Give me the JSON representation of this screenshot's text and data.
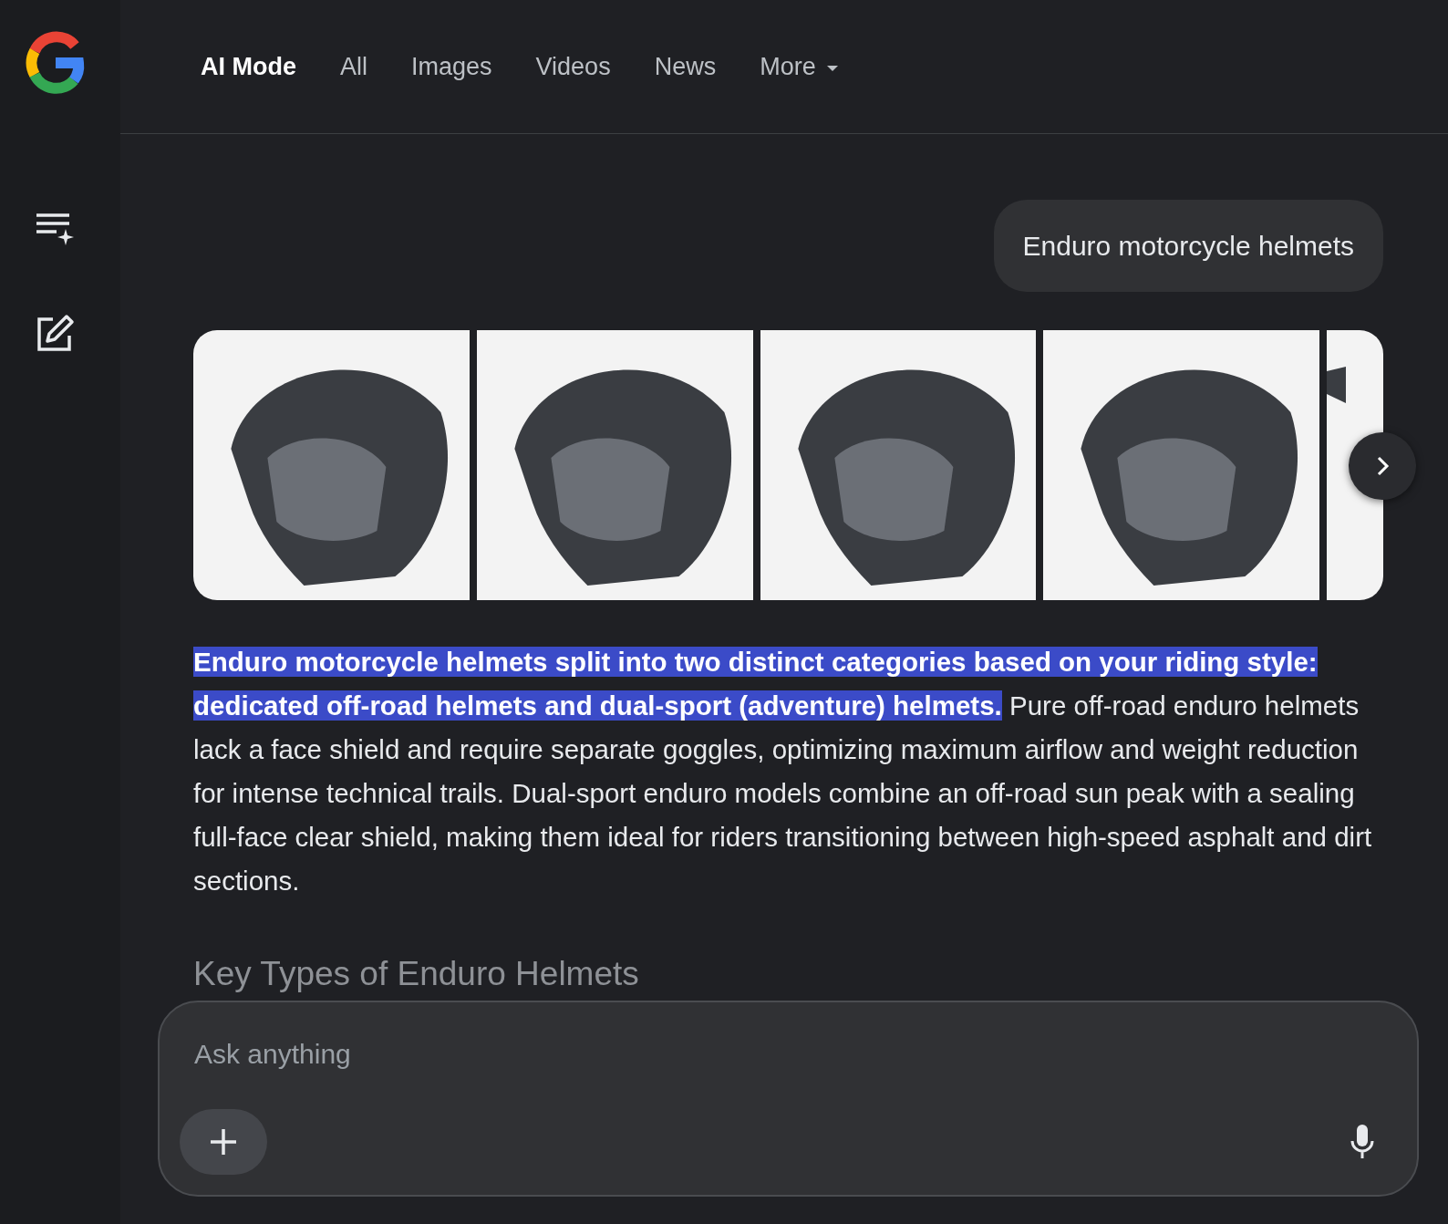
{
  "tabs": [
    {
      "label": "AI Mode",
      "selected": true
    },
    {
      "label": "All",
      "selected": false
    },
    {
      "label": "Images",
      "selected": false
    },
    {
      "label": "Videos",
      "selected": false
    },
    {
      "label": "News",
      "selected": false
    },
    {
      "label": "More",
      "selected": false,
      "kind": "dropdown"
    }
  ],
  "query": "Enduro motorcycle helmets",
  "images": [
    {
      "kind": "full"
    },
    {
      "kind": "full"
    },
    {
      "kind": "full"
    },
    {
      "kind": "full"
    },
    {
      "kind": "partial"
    }
  ],
  "answer": "**Enduro motorcycle helmets split into two distinct categories based on your riding style: dedicated off-road helmets and dual-sport (adventure) helmets.** Pure off-road enduro helmets lack a face shield and require separate goggles, optimizing maximum airflow and weight reduction for intense technical trails. Dual-sport enduro models combine an off-road sun peak with a sealing full-face clear shield, making them ideal for riders transitioning between high-speed asphalt and dirt sections.",
  "section_heading": "Key Types of Enduro Helmets",
  "input": {
    "placeholder": "Ask anything"
  }
}
